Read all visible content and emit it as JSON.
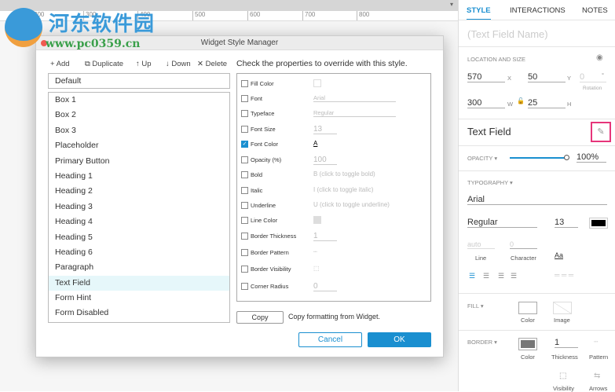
{
  "ruler": {
    "ticks": [
      "200",
      "300",
      "400",
      "500",
      "600",
      "700",
      "800"
    ]
  },
  "watermark": {
    "name": "河东软件园",
    "url": "www.pc0359.cn"
  },
  "dialog": {
    "title": "Widget Style Manager",
    "toolbar": {
      "add": "+ Add",
      "duplicate": "⧉ Duplicate",
      "up": "↑ Up",
      "down": "↓ Down",
      "delete": "✕ Delete"
    },
    "default_style": "Default",
    "styles": [
      "Box 1",
      "Box 2",
      "Box 3",
      "Placeholder",
      "Primary Button",
      "Heading 1",
      "Heading 2",
      "Heading 3",
      "Heading 4",
      "Heading 5",
      "Heading 6",
      "Paragraph",
      "Text Field",
      "Form Hint",
      "Form Disabled"
    ],
    "selected": "Text Field",
    "props_heading": "Check the properties to override with this style.",
    "props": [
      {
        "label": "Fill Color",
        "checked": false,
        "value": ""
      },
      {
        "label": "Font",
        "checked": false,
        "value": "Arial"
      },
      {
        "label": "Typeface",
        "checked": false,
        "value": "Regular"
      },
      {
        "label": "Font Size",
        "checked": false,
        "value": "13"
      },
      {
        "label": "Font Color",
        "checked": true,
        "value": "A"
      },
      {
        "label": "Opacity (%)",
        "checked": false,
        "value": "100"
      },
      {
        "label": "Bold",
        "checked": false,
        "value": "B  (click to toggle bold)"
      },
      {
        "label": "Italic",
        "checked": false,
        "value": "I  (click to toggle italic)"
      },
      {
        "label": "Underline",
        "checked": false,
        "value": "U  (click to toggle underline)"
      },
      {
        "label": "Line Color",
        "checked": false,
        "value": ""
      },
      {
        "label": "Border Thickness",
        "checked": false,
        "value": "1"
      },
      {
        "label": "Border Pattern",
        "checked": false,
        "value": "┄"
      },
      {
        "label": "Border Visibility",
        "checked": false,
        "value": "⬚"
      },
      {
        "label": "Corner Radius",
        "checked": false,
        "value": "0"
      }
    ],
    "copy_button": "Copy",
    "copy_text": "Copy formatting from Widget.",
    "cancel": "Cancel",
    "ok": "OK"
  },
  "panel": {
    "tabs": [
      "STYLE",
      "INTERACTIONS",
      "NOTES"
    ],
    "name_placeholder": "(Text Field Name)",
    "location_label": "LOCATION AND SIZE",
    "x": "570",
    "x_lbl": "X",
    "y": "50",
    "y_lbl": "Y",
    "rotation": "0",
    "rotation_lbl": "Rotation",
    "deg": "°",
    "w": "300",
    "w_lbl": "W",
    "h": "25",
    "h_lbl": "H",
    "style_name": "Text Field",
    "opacity_label": "OPACITY ▾",
    "opacity": "100%",
    "opacity_value": 100,
    "typography_label": "TYPOGRAPHY ▾",
    "font": "Arial",
    "typeface": "Regular",
    "size": "13",
    "line": "auto",
    "line_lbl": "Line",
    "char": "0",
    "char_lbl": "Character",
    "aa": "Aa",
    "fill_label": "FILL ▾",
    "fill_color": "Color",
    "fill_image": "Image",
    "border_label": "BORDER ▾",
    "border_color": "Color",
    "thickness": "1",
    "thickness_lbl": "Thickness",
    "pattern": "Pattern",
    "visibility": "Visibility",
    "arrows": "Arrows",
    "accent": "#1a8fd0",
    "highlight": "#e6357a"
  }
}
